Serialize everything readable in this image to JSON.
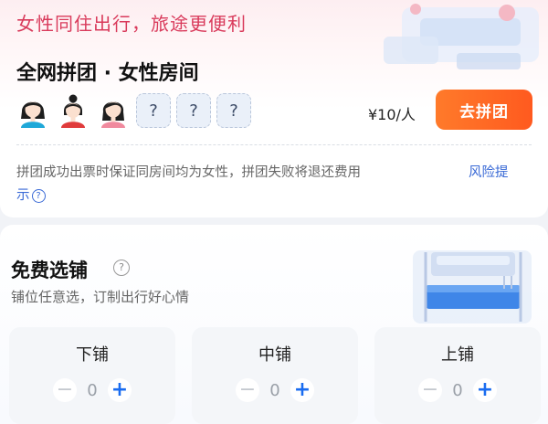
{
  "banner": {
    "title": "女性同住出行，旅途更便利"
  },
  "group": {
    "title": "全网拼团 · 女性房间",
    "slots": [
      "?",
      "?",
      "?"
    ],
    "price": "¥10/人",
    "button_label": "去拼团",
    "notice": "拼团成功出票时保证同房间均为女性，拼团失败将退还费用",
    "risk_link_part1": "风险提",
    "risk_link_part2": "示"
  },
  "berth_section": {
    "title": "免费选铺",
    "subtitle": "铺位任意选，订制出行好心情",
    "berths": [
      {
        "name": "下铺",
        "count": "0"
      },
      {
        "name": "中铺",
        "count": "0"
      },
      {
        "name": "上铺",
        "count": "0"
      }
    ]
  },
  "colors": {
    "accent_pink": "#d93a5b",
    "button_orange": "#ff6a22",
    "link_blue": "#3a6ad6",
    "plus_blue": "#1a6cf0"
  },
  "icons": {
    "help": "question-circle-icon",
    "avatar": "female-avatar-icon",
    "minus": "minus-icon",
    "plus": "plus-icon"
  }
}
